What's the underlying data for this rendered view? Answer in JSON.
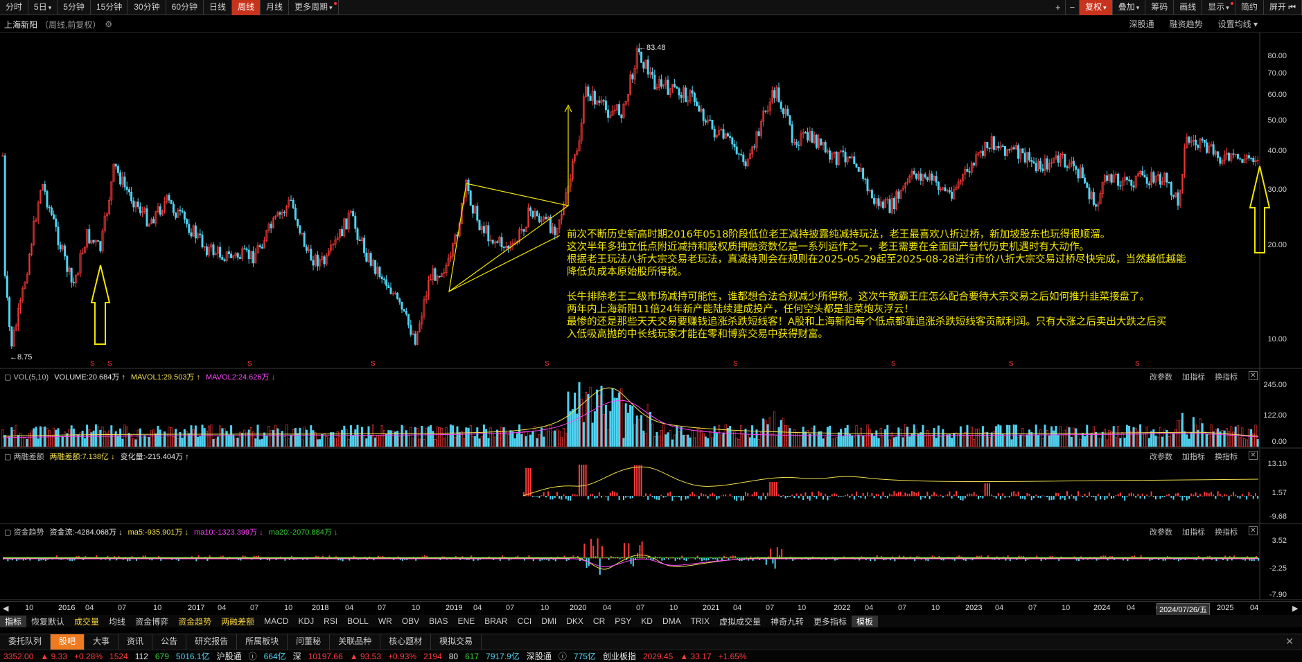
{
  "toolbar": {
    "left": [
      "分时",
      "5日",
      "5分钟",
      "15分钟",
      "30分钟",
      "60分钟",
      "日线",
      "周线",
      "月线",
      "更多周期"
    ],
    "active": "周线",
    "right": [
      "复权",
      "叠加",
      "筹码",
      "画线",
      "显示",
      "简约",
      "屏开"
    ]
  },
  "title": {
    "name": "上海新阳",
    "sub": "（周线,前复权）",
    "right": [
      "深股通",
      "融资趋势",
      "设置均线"
    ]
  },
  "price_axis": [
    "80.00",
    "70.00",
    "60.00",
    "50.00",
    "40.00",
    "30.00",
    "20.00",
    "10.00"
  ],
  "peak": "83.48",
  "low": "8.75",
  "annotation": [
    "前次不断历史新高时期2016年0518阶段低位老王减持披露纯减持玩法，老王最喜欢八折过桥，新加坡股东也玩得很顺溜。",
    "这次半年多独立低点附近减持和股权质押融资数亿是一系列运作之一，老王需要在全面国产替代历史机遇时有大动作。",
    "根据老王玩法八折大宗交易老玩法，真减持则会在规则在2025-05-29起至2025-08-28进行市价八折大宗交易过桥尽快完成，当然越低越能",
    "降低负成本原始股所得税。",
    "",
    "长牛排除老王二级市场减持可能性，谁都想合法合规减少所得税。这次牛散霸王庄怎么配合要待大宗交易之后如何推升韭菜接盘了。",
    "两年内上海新阳11倍24年新产能陆续建成投产，任何空头都是韭菜炮灰浮云！",
    "最惨的还是那些天天交易要赚钱追涨杀跌短线客！A股和上海新阳每个低点都靠追涨杀跌短线客贡献利润。只有大涨之后卖出大跌之后买",
    "入低吸高抛的中长线玩家才能在零和博弈交易中获得财富。"
  ],
  "vol_panel": {
    "label": "VOL(5,10)",
    "items": [
      "VOLUME:20.684万 ↑",
      "MAVOL1:29.503万 ↑",
      "MAVOL2:24.626万 ↓"
    ],
    "axis": [
      "245.00",
      "122.00",
      "0.00"
    ],
    "actions": [
      "改参数",
      "加指标",
      "换指标"
    ]
  },
  "margin_panel": {
    "label": "两融差额",
    "items": [
      "两融差额:7.138亿 ↓",
      "变化量:-215.404万 ↑"
    ],
    "axis": [
      "13.10",
      "1.57",
      "-9.68"
    ],
    "actions": [
      "改参数",
      "加指标",
      "换指标"
    ]
  },
  "fund_panel": {
    "label": "资金趋势",
    "items": [
      "资金流:-4284.068万 ↓",
      "ma5:-935.901万 ↓",
      "ma10:-1323.399万 ↓",
      "ma20:-2070.884万 ↓"
    ],
    "axis": [
      "3.52",
      "-2.25",
      "-7.90"
    ],
    "actions": [
      "改参数",
      "加指标",
      "换指标"
    ]
  },
  "xaxis": {
    "labels": [
      "10",
      "2016",
      "04",
      "07",
      "10",
      "2017",
      "04",
      "07",
      "10",
      "2018",
      "04",
      "07",
      "10",
      "2019",
      "04",
      "07",
      "10",
      "2020",
      "04",
      "07",
      "10",
      "2021",
      "04",
      "07",
      "10",
      "2022",
      "04",
      "07",
      "10",
      "2023",
      "04",
      "07",
      "10",
      "2024",
      "04",
      "0"
    ],
    "cursor_date": "2024/07/26/五",
    "tail": [
      "2025",
      "04"
    ]
  },
  "indicators": [
    "指标",
    "恢复默认",
    "成交量",
    "均线",
    "资金博弈",
    "资金趋势",
    "两融差额",
    "MACD",
    "KDJ",
    "RSI",
    "BOLL",
    "WR",
    "OBV",
    "BIAS",
    "ENE",
    "BRAR",
    "CCI",
    "DMI",
    "DKX",
    "CR",
    "PSY",
    "KD",
    "DMA",
    "TRIX",
    "虚拟成交量",
    "神奇九转",
    "更多指标",
    "模板"
  ],
  "func_tabs": [
    "委托队列",
    "股吧",
    "大事",
    "资讯",
    "公告",
    "研究报告",
    "所属板块",
    "问董秘",
    "关联品种",
    "核心题材",
    "模拟交易"
  ],
  "func_active": "股吧",
  "status": {
    "sh_index": "3352.00",
    "sh_chg": "▲ 9.33",
    "sh_pct": "+0.28%",
    "sh_up": "1524",
    "sh_flat": "112",
    "sh_down": "679",
    "sh_amt": "5016.1亿",
    "hgt_label": "沪股通",
    "hgt_val": "664亿",
    "sz_label": "深",
    "sz_index": "10197.66",
    "sz_chg": "▲ 93.53",
    "sz_pct": "+0.93%",
    "sz_up": "2194",
    "sz_flat": "80",
    "sz_down": "617",
    "sz_amt": "7917.9亿",
    "sgt_label": "深股通",
    "sgt_val": "775亿",
    "cyb_label": "创业板指",
    "cyb_index": "2029.45",
    "cyb_chg": "▲ 33.17",
    "cyb_pct": "+1.65%"
  },
  "colors": {
    "up": "#ff3b3b",
    "down": "#4fd2f0",
    "ma1": "#f4e04d",
    "ma2": "#ff44ff",
    "ma3": "#33cc33",
    "annotation": "#f2e600",
    "accent": "#c8331d"
  }
}
